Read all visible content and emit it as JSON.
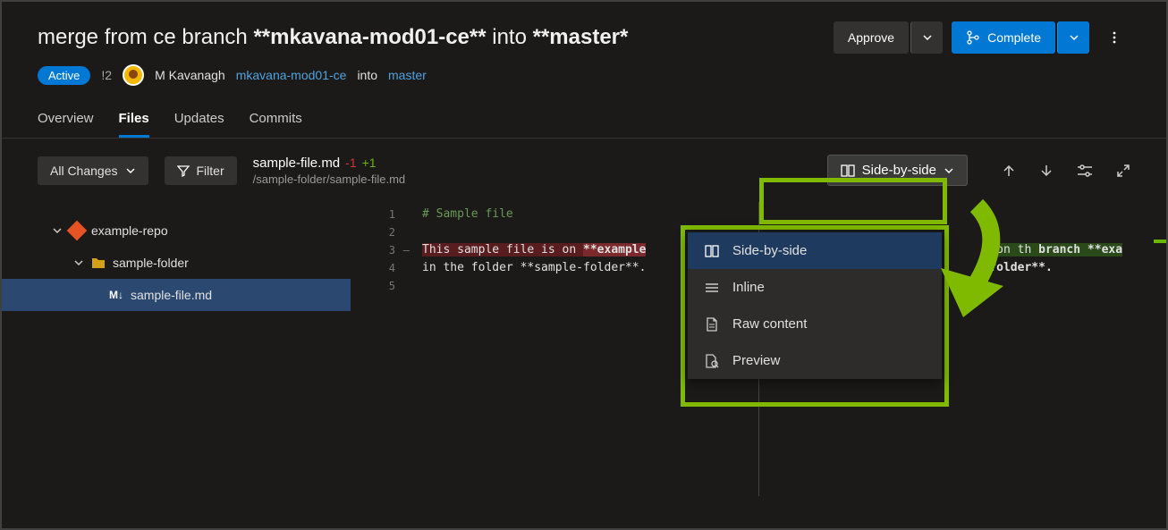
{
  "header": {
    "title_prefix": "merge from ce branch ",
    "title_source": "**mkavana-mod01-ce**",
    "title_mid": " into ",
    "title_target": "**master*",
    "approve_label": "Approve",
    "complete_label": "Complete"
  },
  "meta": {
    "active_label": "Active",
    "issue_count": "!2",
    "author": "M Kavanagh",
    "source_branch": "mkavana-mod01-ce",
    "into_label": "into",
    "target_branch": "master"
  },
  "tabs": [
    {
      "label": "Overview",
      "active": false
    },
    {
      "label": "Files",
      "active": true
    },
    {
      "label": "Updates",
      "active": false
    },
    {
      "label": "Commits",
      "active": false
    }
  ],
  "toolbar": {
    "all_changes": "All Changes",
    "filter": "Filter",
    "file_name": "sample-file.md",
    "diff_neg": "-1",
    "diff_pos": "+1",
    "file_path": "/sample-folder/sample-file.md",
    "view_mode": "Side-by-side"
  },
  "tree": {
    "repo": "example-repo",
    "folder": "sample-folder",
    "file": "sample-file.md",
    "file_prefix": "M↓"
  },
  "diff": {
    "line_numbers": [
      "1",
      "2",
      "3",
      "4",
      "5"
    ],
    "left": {
      "l1": "# Sample file",
      "l3_a": "This sample file is on ",
      "l3_b": "**example",
      "l4": "in the folder **sample-folder**."
    },
    "right": {
      "l3_a": "e on th",
      "l3_b": " branch **exa",
      "l4": "-folder**."
    }
  },
  "menu": {
    "items": [
      {
        "label": "Side-by-side",
        "icon": "columns-icon",
        "selected": true
      },
      {
        "label": "Inline",
        "icon": "lines-icon",
        "selected": false
      },
      {
        "label": "Raw content",
        "icon": "document-icon",
        "selected": false
      },
      {
        "label": "Preview",
        "icon": "preview-icon",
        "selected": false
      }
    ]
  }
}
